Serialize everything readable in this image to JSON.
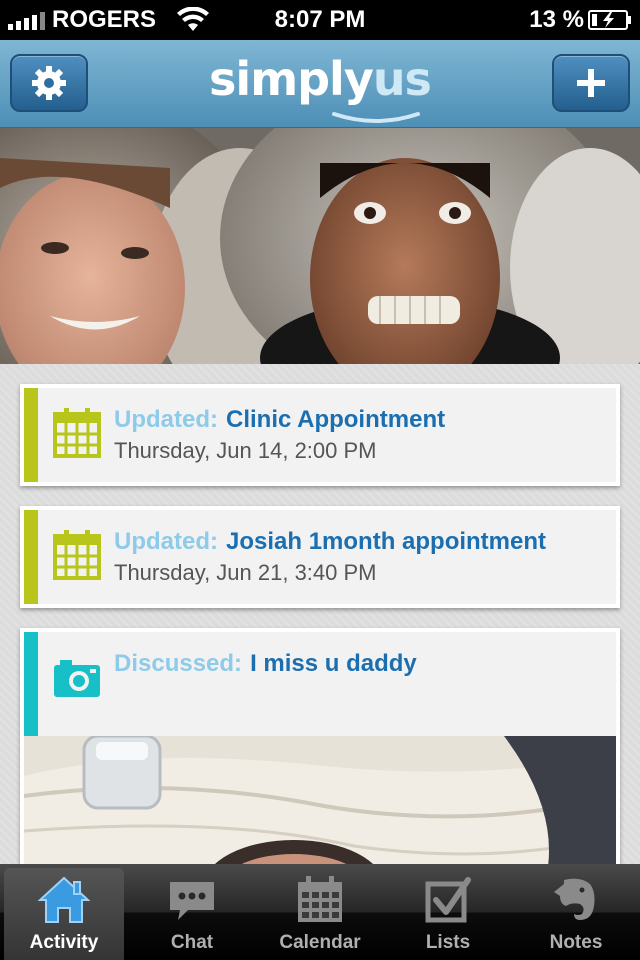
{
  "status_bar": {
    "carrier": "ROGERS",
    "time": "8:07 PM",
    "battery_percent": "13 %"
  },
  "nav": {
    "logo_primary": "simply",
    "logo_secondary": "us"
  },
  "feed": [
    {
      "verb": "Updated:",
      "subject": "Clinic Appointment",
      "detail": "Thursday, Jun 14, 2:00 PM",
      "icon": "calendar-icon",
      "accent": "#b8c51a"
    },
    {
      "verb": "Updated:",
      "subject": "Josiah 1month appointment",
      "detail": "Thursday, Jun 21, 3:40 PM",
      "icon": "calendar-icon",
      "accent": "#b8c51a"
    },
    {
      "verb": "Discussed:",
      "subject": "I miss u daddy",
      "icon": "camera-icon",
      "accent": "#17c0c7"
    }
  ],
  "tabs": [
    {
      "label": "Activity",
      "icon": "home-icon",
      "active": true
    },
    {
      "label": "Chat",
      "icon": "chat-bubble-icon"
    },
    {
      "label": "Calendar",
      "icon": "calendar-icon"
    },
    {
      "label": "Lists",
      "icon": "checkbox-icon"
    },
    {
      "label": "Notes",
      "icon": "elephant-icon"
    }
  ],
  "colors": {
    "nav_blue": "#5f9fc6",
    "verb_light_blue": "#8ecbea",
    "subject_blue": "#1b6fb0",
    "active_tab_blue": "#3a9be0"
  }
}
